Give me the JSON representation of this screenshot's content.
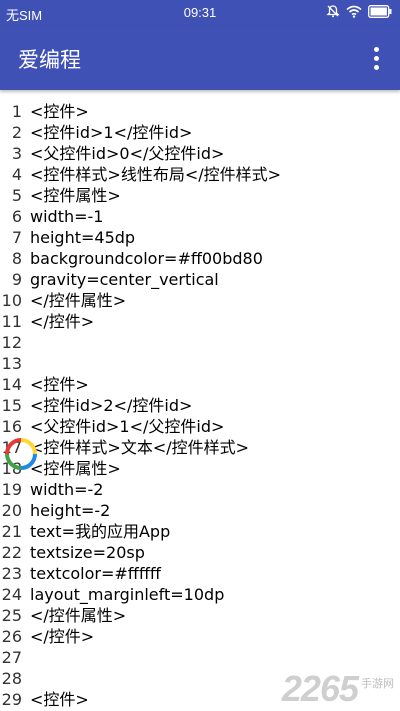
{
  "status_bar": {
    "carrier": "无SIM",
    "time": "09:31"
  },
  "app_bar": {
    "title": "爱编程",
    "overflow_icon": "more-vert-icon"
  },
  "colors": {
    "primary": "#3f51b5",
    "loader": [
      "#e53935",
      "#43a047",
      "#1e88e5",
      "#fdd835"
    ]
  },
  "editor": {
    "lines": [
      {
        "n": "1",
        "text": "<控件>"
      },
      {
        "n": "2",
        "text": "<控件id>1</控件id>"
      },
      {
        "n": "3",
        "text": "<父控件id>0</父控件id>"
      },
      {
        "n": "4",
        "text": "<控件样式>线性布局</控件样式>"
      },
      {
        "n": "5",
        "text": "<控件属性>"
      },
      {
        "n": "6",
        "text": "width=-1"
      },
      {
        "n": "7",
        "text": "height=45dp"
      },
      {
        "n": "8",
        "text": "backgroundcolor=#ff00bd80"
      },
      {
        "n": "9",
        "text": "gravity=center_vertical"
      },
      {
        "n": "10",
        "text": "</控件属性>"
      },
      {
        "n": "11",
        "text": "</控件>"
      },
      {
        "n": "12",
        "text": ""
      },
      {
        "n": "13",
        "text": ""
      },
      {
        "n": "14",
        "text": "<控件>"
      },
      {
        "n": "15",
        "text": "<控件id>2</控件id>"
      },
      {
        "n": "16",
        "text": "<父控件id>1</父控件id>"
      },
      {
        "n": "17",
        "text": "<控件样式>文本</控件样式>"
      },
      {
        "n": "18",
        "text": "<控件属性>"
      },
      {
        "n": "19",
        "text": "width=-2"
      },
      {
        "n": "20",
        "text": "height=-2"
      },
      {
        "n": "21",
        "text": "text=我的应用App"
      },
      {
        "n": "22",
        "text": "textsize=20sp"
      },
      {
        "n": "23",
        "text": "textcolor=#ffffff"
      },
      {
        "n": "24",
        "text": "layout_marginleft=10dp"
      },
      {
        "n": "25",
        "text": "</控件属性>"
      },
      {
        "n": "26",
        "text": "</控件>"
      },
      {
        "n": "27",
        "text": ""
      },
      {
        "n": "28",
        "text": ""
      },
      {
        "n": "29",
        "text": "<控件>"
      }
    ]
  },
  "watermark": {
    "big": "2265",
    "small": "手游网"
  }
}
